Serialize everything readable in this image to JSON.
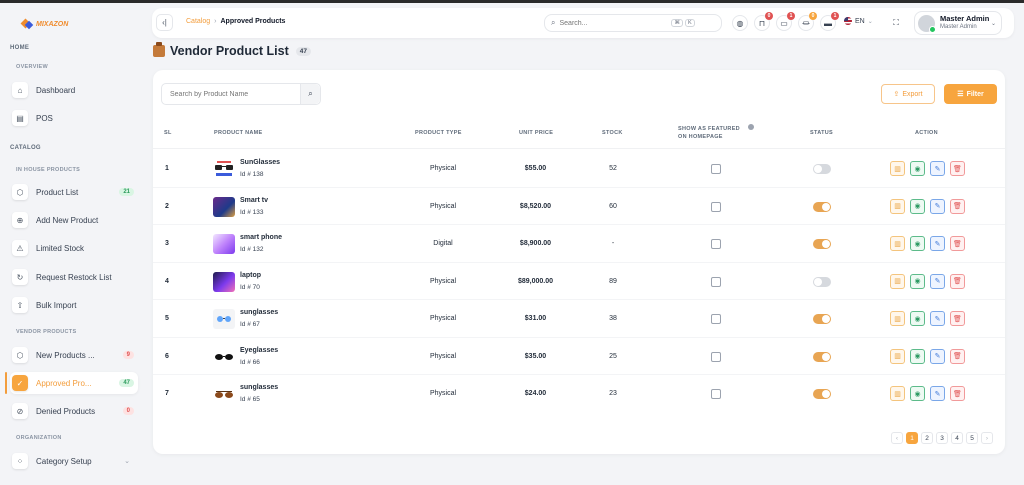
{
  "app": {
    "logo_text": "MIXAZON"
  },
  "sidebar": {
    "home_title": "HOME",
    "overview_title": "OVERVIEW",
    "catalog_title": "CATALOG",
    "in_house_title": "IN HOUSE PRODUCTS",
    "vendor_title": "VENDOR PRODUCTS",
    "organization_title": "ORGANIZATION",
    "items": [
      {
        "label": "Dashboard",
        "icon": "home-icon"
      },
      {
        "label": "POS",
        "icon": "pos-icon"
      },
      {
        "label": "Product List",
        "icon": "box-icon",
        "badge": "21"
      },
      {
        "label": "Add New Product",
        "icon": "plus-circle-icon"
      },
      {
        "label": "Limited Stock",
        "icon": "warning-icon"
      },
      {
        "label": "Request Restock List",
        "icon": "refresh-icon"
      },
      {
        "label": "Bulk Import",
        "icon": "upload-icon"
      },
      {
        "label": "New Products ...",
        "icon": "box-icon",
        "badge": "9"
      },
      {
        "label": "Approved Pro...",
        "icon": "check-badge-icon",
        "badge": "47"
      },
      {
        "label": "Denied Products",
        "icon": "ban-icon",
        "badge": "0"
      },
      {
        "label": "Category Setup",
        "icon": "category-icon"
      }
    ]
  },
  "header": {
    "breadcrumb_parent": "Catalog",
    "breadcrumb_sep": "›",
    "breadcrumb_current": "Approved Products",
    "search_placeholder": "Search...",
    "kbd_1": "⌘",
    "kbd_2": "K",
    "badges": {
      "orders": "0",
      "messages": "1",
      "bank": "0",
      "wallet": "1"
    },
    "language": "EN",
    "user_name": "Master Admin",
    "user_role": "Master Admin"
  },
  "page": {
    "title": "Vendor Product List",
    "count": "47"
  },
  "toolbar": {
    "search_placeholder": "Search by Product Name",
    "export_label": "Export",
    "filter_label": "Filter"
  },
  "table": {
    "headers": {
      "sl": "SL",
      "name": "PRODUCT NAME",
      "type": "PRODUCT TYPE",
      "price": "UNIT PRICE",
      "stock": "STOCK",
      "featured_1": "SHOW AS FEATURED",
      "featured_2": "ON HOMEPAGE",
      "status": "STATUS",
      "action": "ACTION"
    },
    "rows": [
      {
        "sl": "1",
        "name": "SunGlasses",
        "id": "Id # 138",
        "type": "Physical",
        "price": "$55.00",
        "stock": "52",
        "status": "off"
      },
      {
        "sl": "2",
        "name": "Smart tv",
        "id": "Id # 133",
        "type": "Physical",
        "price": "$8,520.00",
        "stock": "60",
        "status": "on"
      },
      {
        "sl": "3",
        "name": "smart phone",
        "id": "Id # 132",
        "type": "Digital",
        "price": "$8,900.00",
        "stock": "-",
        "status": "on"
      },
      {
        "sl": "4",
        "name": "laptop",
        "id": "Id # 70",
        "type": "Physical",
        "price": "$89,000.00",
        "stock": "89",
        "status": "off"
      },
      {
        "sl": "5",
        "name": "sunglasses",
        "id": "Id # 67",
        "type": "Physical",
        "price": "$31.00",
        "stock": "38",
        "status": "on"
      },
      {
        "sl": "6",
        "name": "Eyeglasses",
        "id": "Id # 66",
        "type": "Physical",
        "price": "$35.00",
        "stock": "25",
        "status": "on"
      },
      {
        "sl": "7",
        "name": "sunglasses",
        "id": "Id # 65",
        "type": "Physical",
        "price": "$24.00",
        "stock": "23",
        "status": "on"
      }
    ]
  },
  "pagination": {
    "prev": "‹",
    "pages": [
      "1",
      "2",
      "3",
      "4",
      "5"
    ],
    "next": "›",
    "current": "1"
  },
  "colors": {
    "accent": "#f7a53e",
    "success": "#2e9b64",
    "danger": "#e05252",
    "info": "#3b77d8"
  }
}
